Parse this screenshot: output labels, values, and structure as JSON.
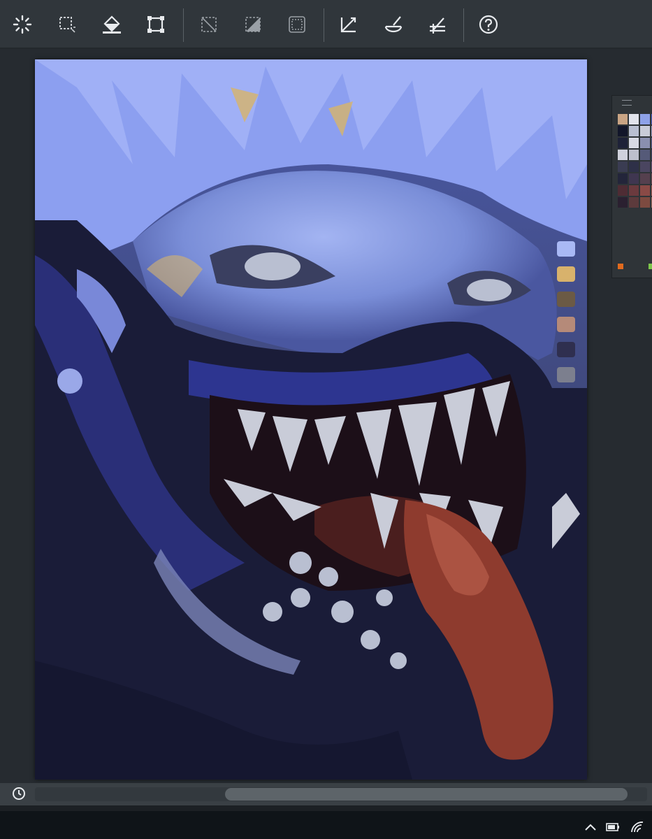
{
  "toolbar": {
    "tools": [
      {
        "name": "adjustments-icon",
        "interactable": true
      },
      {
        "name": "selection-icon",
        "interactable": true
      },
      {
        "name": "fill-bucket-icon",
        "interactable": true
      },
      {
        "name": "transform-icon",
        "interactable": true
      },
      {
        "name": "clear-selection-icon",
        "interactable": true
      },
      {
        "name": "invert-selection-icon",
        "interactable": true
      },
      {
        "name": "select-all-icon",
        "interactable": true
      },
      {
        "name": "ruler-perspective-icon",
        "interactable": true
      },
      {
        "name": "ruler-ellipse-icon",
        "interactable": true
      },
      {
        "name": "ruler-symmetry-icon",
        "interactable": true
      },
      {
        "name": "help-icon",
        "interactable": true
      }
    ]
  },
  "colors": {
    "toolbar_bg": "#30363b",
    "icon": "#e8ebee",
    "canvas_bg": "#3a3f63"
  },
  "palette": {
    "swatches": [
      "#c9a484",
      "#e2e4ec",
      "#8ea2e8",
      "#4a61c8",
      "#12162a",
      "#b9bfd1",
      "#c9ccd8",
      "#9da3c6",
      "#1e2238",
      "#d8dae4",
      "#8a8fb0",
      "#5a6290",
      "#cfd1dc",
      "#bdbfcc",
      "#555a78",
      "#3d4260",
      "#3a3c52",
      "#2e3048",
      "#4a4560",
      "#625074",
      "#23253a",
      "#3f3650",
      "#55404e",
      "#6e4a52",
      "#4e2c34",
      "#6b3a3e",
      "#8a4a46",
      "#a05a50",
      "#2a2030",
      "#5c3a3c",
      "#7d4a40",
      "#9a6a5a"
    ]
  },
  "quick_swatches": [
    "#a9b9f5",
    "#d8b26c",
    "#6b5a45",
    "#b58a79",
    "#2f2f4f",
    "#7c7f8e"
  ],
  "taskbar": {
    "tray_icons": [
      "chevron-up-icon",
      "battery-icon",
      "wifi-icon"
    ]
  }
}
